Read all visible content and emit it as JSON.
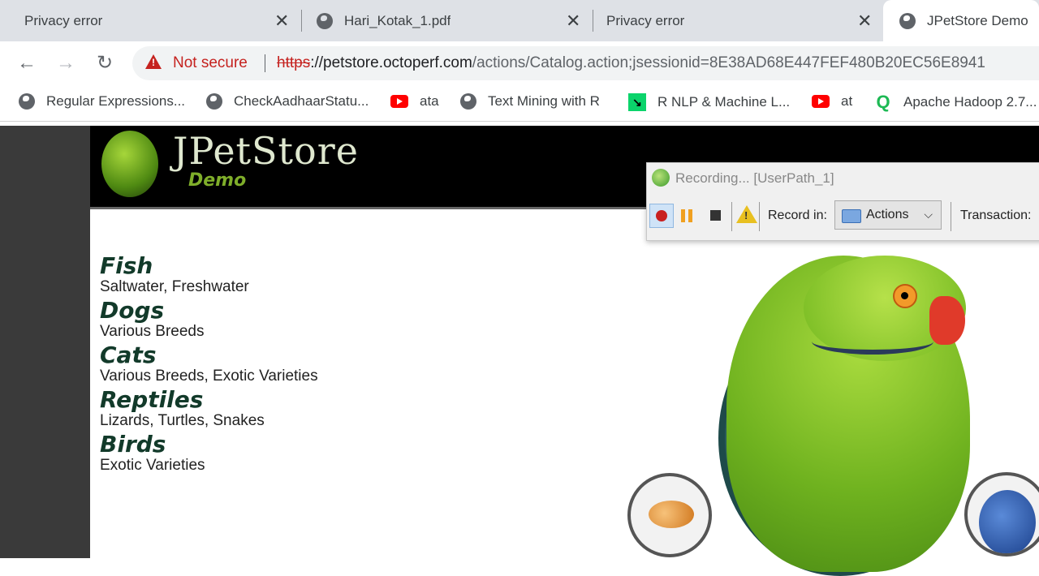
{
  "browser": {
    "tabs": [
      {
        "title": "Privacy error",
        "active": false
      },
      {
        "title": "Hari_Kotak_1.pdf",
        "active": false
      },
      {
        "title": "Privacy error",
        "active": false
      },
      {
        "title": "JPetStore Demo",
        "active": true
      }
    ],
    "omnibox": {
      "security_label": "Not secure",
      "url_scheme": "https",
      "url_host": "://petstore.octoperf.com",
      "url_path": "/actions/Catalog.action;jsessionid=8E38AD68E447FEF480B20EC56E8941"
    },
    "bookmarks": [
      {
        "label": "Regular Expressions...",
        "icon": "globe-icon"
      },
      {
        "label": "CheckAadhaarStatu...",
        "icon": "globe-icon"
      },
      {
        "label": "ata",
        "icon": "youtube-icon"
      },
      {
        "label": "Text Mining with R",
        "icon": "globe-icon"
      },
      {
        "label": "R NLP & Machine L...",
        "icon": "datacamp-icon"
      },
      {
        "label": "at",
        "icon": "youtube-icon"
      },
      {
        "label": "Apache Hadoop 2.7...",
        "icon": "qubole-icon"
      }
    ]
  },
  "site": {
    "logo_title": "JPetStore",
    "logo_subtitle": "Demo",
    "categories": [
      {
        "name": "Fish",
        "description": "Saltwater, Freshwater"
      },
      {
        "name": "Dogs",
        "description": "Various Breeds"
      },
      {
        "name": "Cats",
        "description": "Various Breeds, Exotic Varieties"
      },
      {
        "name": "Reptiles",
        "description": "Lizards, Turtles, Snakes"
      },
      {
        "name": "Birds",
        "description": "Exotic Varieties"
      }
    ]
  },
  "recorder": {
    "title": "Recording... [UserPath_1]",
    "record_in_label": "Record in:",
    "record_in_value": "Actions",
    "transaction_label": "Transaction:"
  }
}
